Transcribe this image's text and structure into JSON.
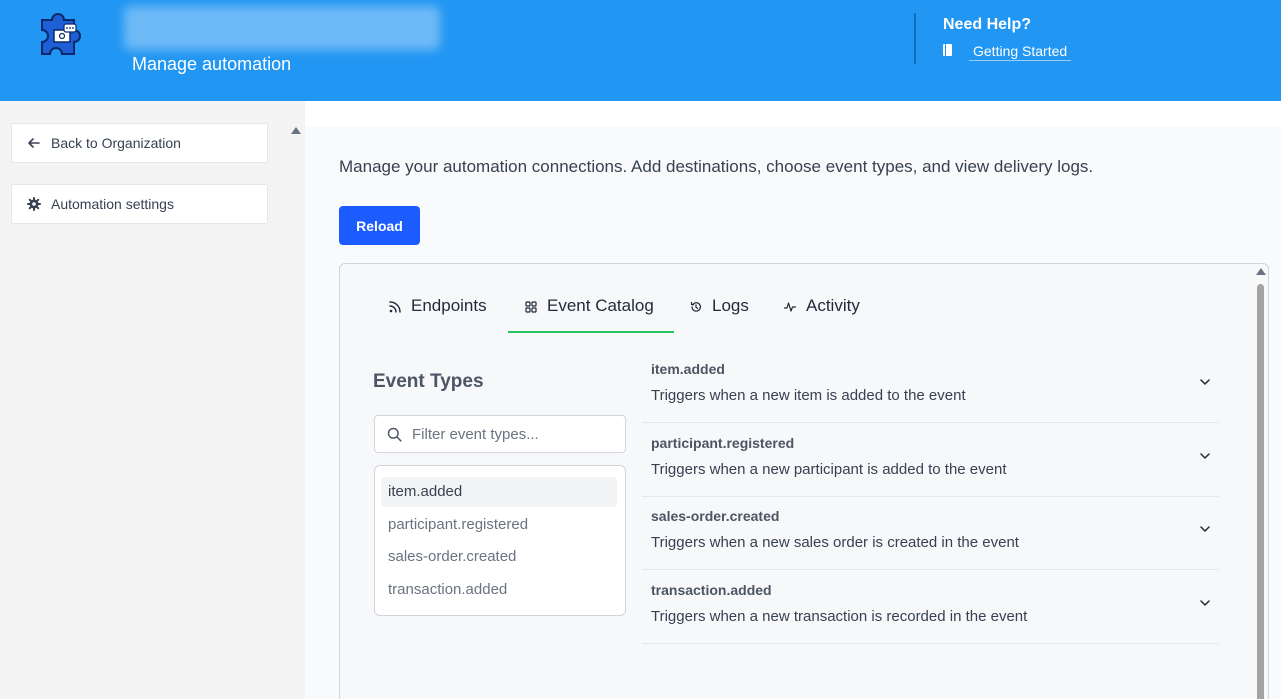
{
  "header": {
    "subtitle": "Manage automation",
    "help_title": "Need Help?",
    "help_link": "Getting Started"
  },
  "sidebar": {
    "items": [
      {
        "label": "Back to Organization",
        "icon": "arrow-left-icon"
      },
      {
        "label": "Automation settings",
        "icon": "gear-icon"
      }
    ]
  },
  "main": {
    "description": "Manage your automation connections. Add destinations, choose event types, and view delivery logs.",
    "reload_label": "Reload",
    "tabs": [
      {
        "label": "Endpoints",
        "icon": "rss-icon"
      },
      {
        "label": "Event Catalog",
        "icon": "grid-icon",
        "active": true
      },
      {
        "label": "Logs",
        "icon": "history-icon"
      },
      {
        "label": "Activity",
        "icon": "activity-icon"
      }
    ],
    "event_types_title": "Event Types",
    "filter_placeholder": "Filter event types...",
    "event_list": [
      "item.added",
      "participant.registered",
      "sales-order.created",
      "transaction.added"
    ],
    "events": [
      {
        "name": "item.added",
        "description": "Triggers when a new item is added to the event"
      },
      {
        "name": "participant.registered",
        "description": "Triggers when a new participant is added to the event"
      },
      {
        "name": "sales-order.created",
        "description": "Triggers when a new sales order is created in the event"
      },
      {
        "name": "transaction.added",
        "description": "Triggers when a new transaction is recorded in the event"
      }
    ]
  },
  "colors": {
    "header_bg": "#2196f3",
    "primary_button": "#1c5cff",
    "active_tab_underline": "#22c55e"
  }
}
